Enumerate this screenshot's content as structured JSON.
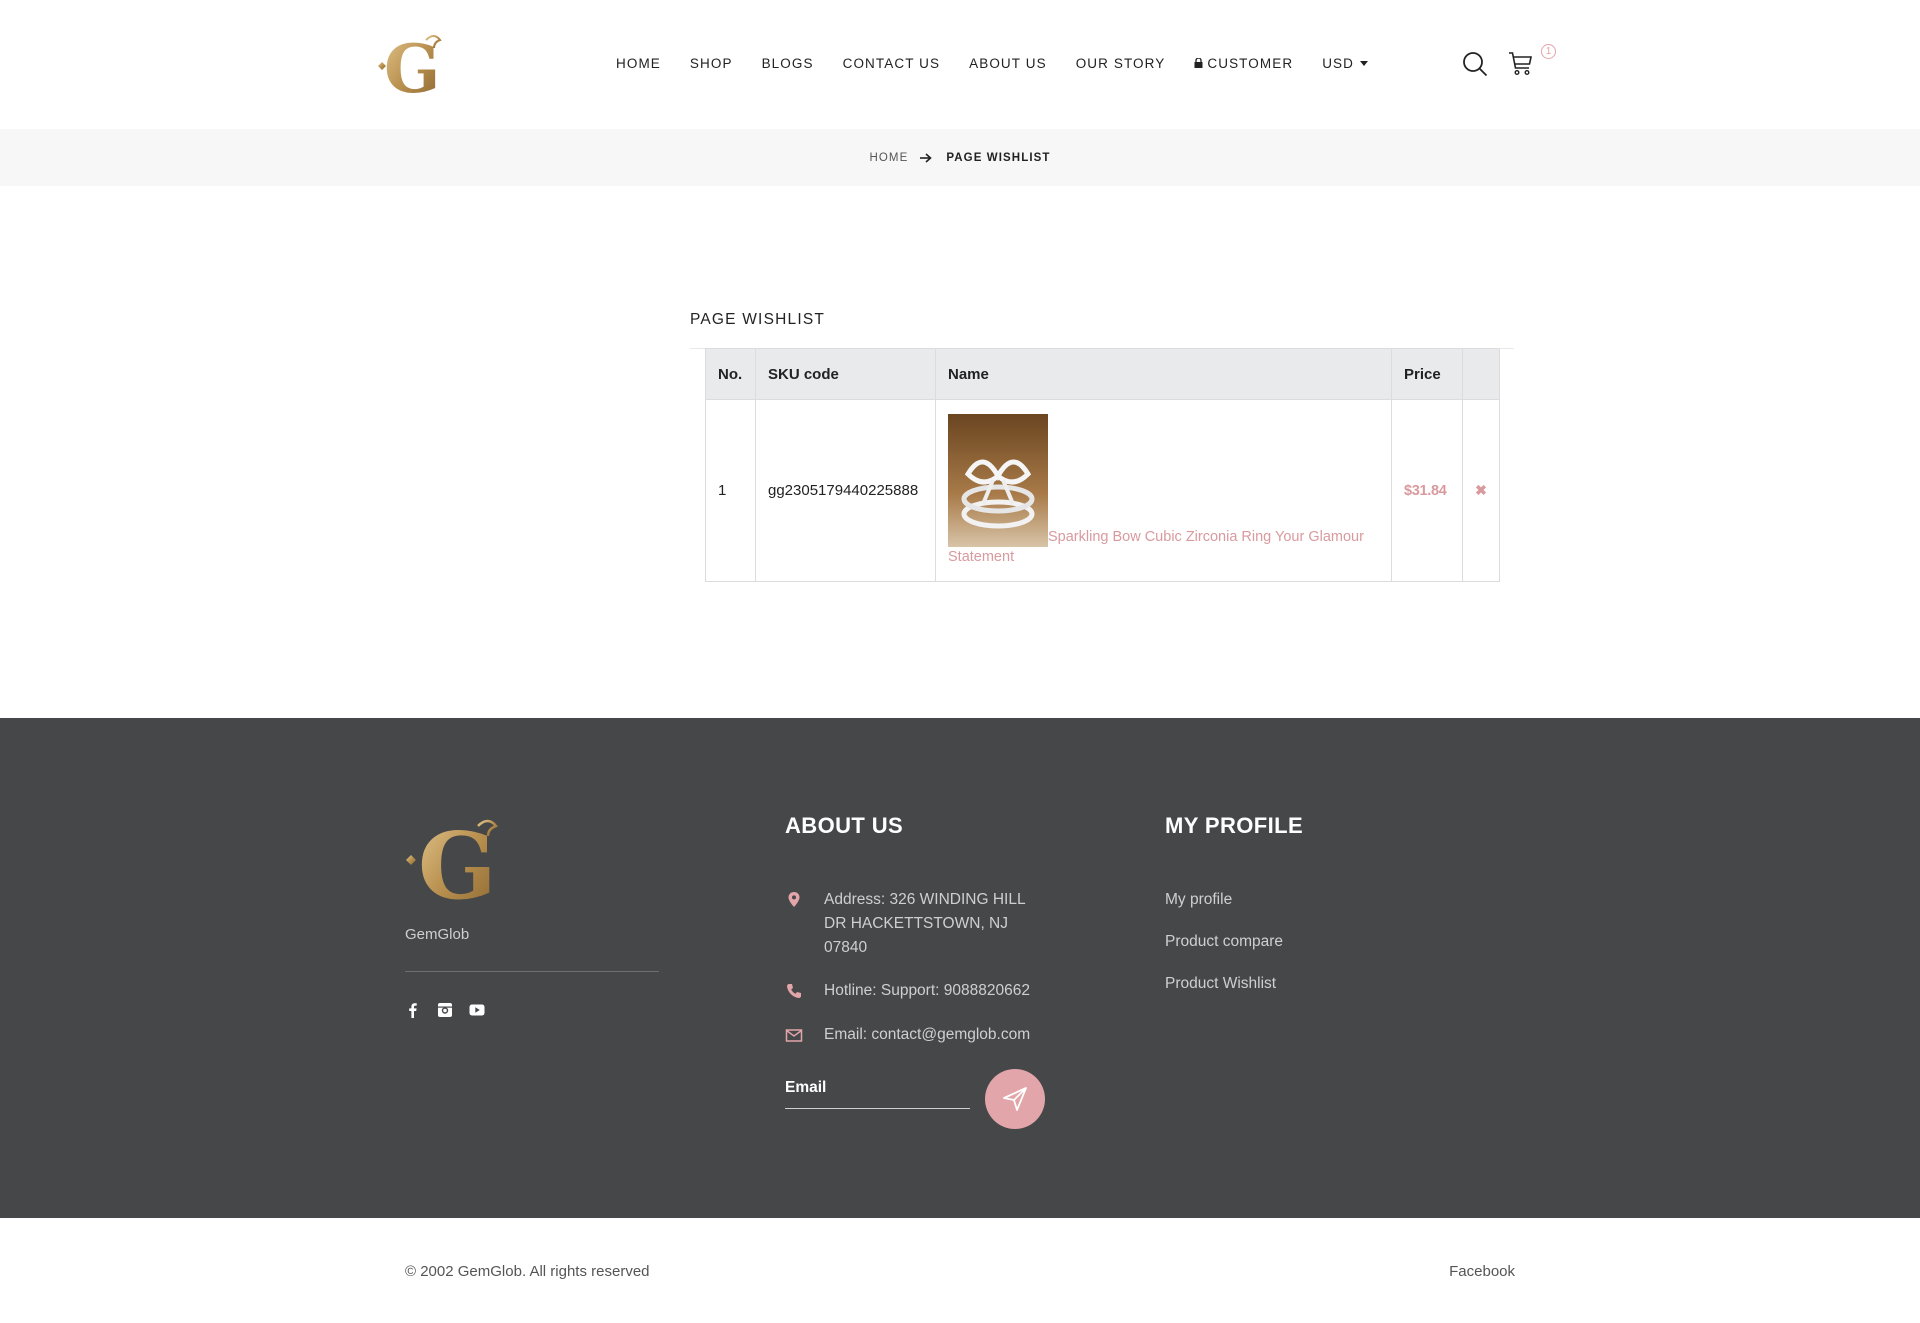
{
  "brand": {
    "name": "GemGlob",
    "logo_letter": "G",
    "gold": "#b8904f",
    "accent": "#e2a5a9",
    "footer_bg": "#464749"
  },
  "header": {
    "nav": [
      {
        "label": "HOME"
      },
      {
        "label": "SHOP"
      },
      {
        "label": "BLOGS"
      },
      {
        "label": "CONTACT US"
      },
      {
        "label": "ABOUT US"
      },
      {
        "label": "OUR STORY"
      },
      {
        "label": "CUSTOMER",
        "icon": "lock-icon"
      },
      {
        "label": "USD",
        "icon": "caret-down-icon"
      }
    ],
    "cart_count": "1",
    "icons": [
      "search-icon",
      "cart-icon"
    ]
  },
  "breadcrumb": {
    "home": "HOME",
    "current": "PAGE WISHLIST"
  },
  "wishlist": {
    "title": "PAGE WISHLIST",
    "columns": [
      "No.",
      "SKU code",
      "Name",
      "Price",
      ""
    ],
    "rows": [
      {
        "no": "1",
        "sku": "gg2305179440225888",
        "name": "Sparkling Bow Cubic Zirconia Ring Your Glamour Statement",
        "price": "$31.84",
        "remove": "✖"
      }
    ]
  },
  "footer": {
    "brand_text": "GemGlob",
    "social": [
      "facebook-icon",
      "instagram-icon",
      "youtube-icon"
    ],
    "about_heading": "ABOUT US",
    "address": "Address: 326 WINDING HILL DR HACKETTSTOWN, NJ 07840",
    "hotline": "Hotline: Support: 9088820662",
    "email": "Email: contact@gemglob.com",
    "email_placeholder": "Email",
    "profile_heading": "MY PROFILE",
    "profile_links": [
      "My profile",
      "Product compare",
      "Product Wishlist"
    ]
  },
  "bottom": {
    "copyright": "© 2002 GemGlob.  All rights reserved",
    "facebook": "Facebook"
  }
}
